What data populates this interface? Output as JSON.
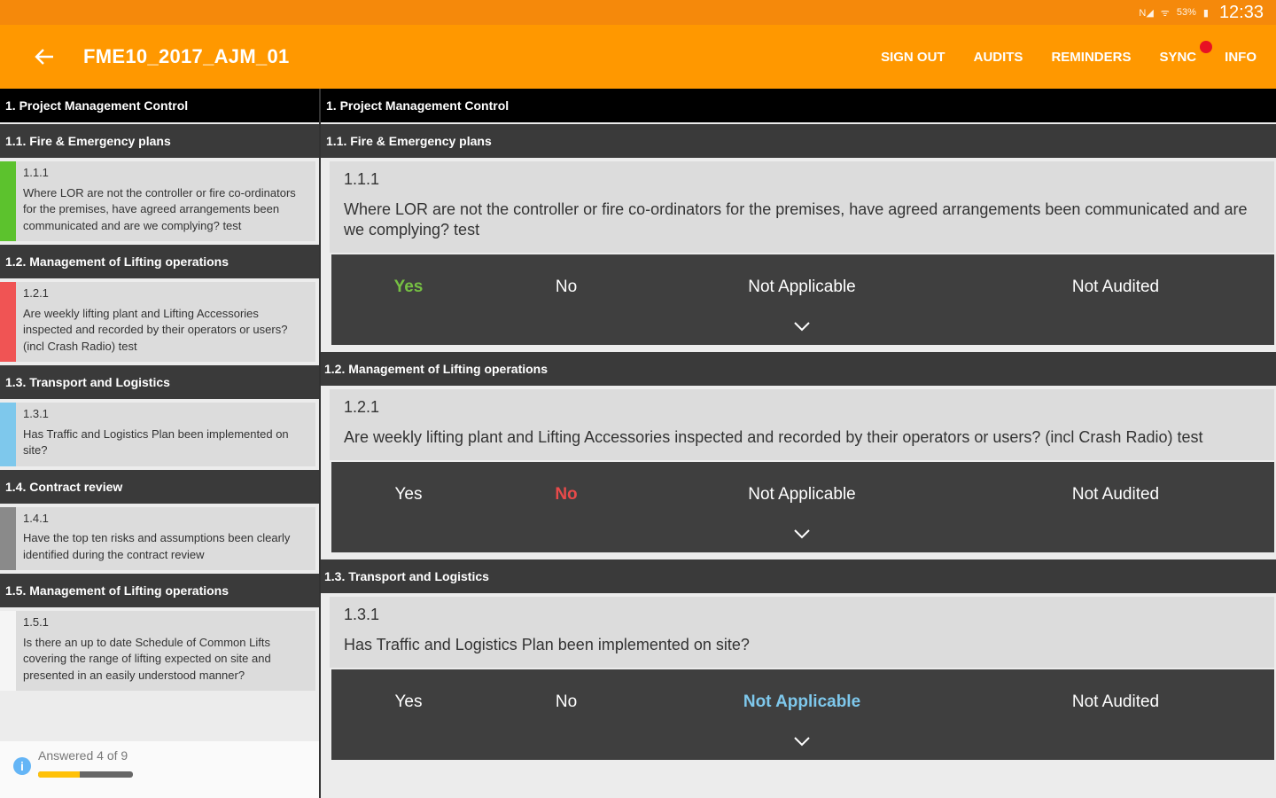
{
  "status": {
    "icons": [
      "nfc-icon",
      "wifi-icon",
      "battery-icon"
    ],
    "battery": "53%",
    "clock": "12:33"
  },
  "appbar": {
    "title": "FME10_2017_AJM_01",
    "actions": [
      "SIGN OUT",
      "AUDITS",
      "REMINDERS",
      "SYNC",
      "INFO"
    ],
    "bg": "#ff9800"
  },
  "left": {
    "section": "1. Project Management Control",
    "groups": [
      {
        "title": "1.1. Fire & Emergency plans",
        "num": "1.1.1",
        "text": "Where LOR are not the controller or fire co-ordinators for the premises, have agreed arrangements been communicated and are we complying? test",
        "status_color": "#5cc22d"
      },
      {
        "title": "1.2. Management of Lifting operations",
        "num": "1.2.1",
        "text": "Are weekly lifting plant and Lifting Accessories inspected and recorded by their operators or users? (incl Crash Radio) test",
        "status_color": "#f05454"
      },
      {
        "title": "1.3. Transport and Logistics",
        "num": "1.3.1",
        "text": "Has Traffic and Logistics Plan been implemented on site?",
        "status_color": "#7ec8ec"
      },
      {
        "title": "1.4. Contract review",
        "num": "1.4.1",
        "text": "Have the top ten risks and assumptions been clearly identified during the contract review",
        "status_color": "#8a8a8a"
      },
      {
        "title": "1.5. Management of Lifting operations",
        "num": "1.5.1",
        "text": "Is there an up to date Schedule of Common Lifts covering the range of lifting expected on site and presented in an easily understood manner?",
        "status_color": "#f5f5f5"
      }
    ],
    "progress": {
      "label": "Answered 4 of 9",
      "fraction": 0.44
    }
  },
  "right": {
    "section": "1. Project Management Control",
    "options": [
      "Yes",
      "No",
      "Not Applicable",
      "Not Audited"
    ],
    "groups": [
      {
        "title": "1.1. Fire & Emergency plans",
        "num": "1.1.1",
        "text": "Where LOR are not the controller or fire co-ordinators for the premises, have agreed arrangements been communicated and are we complying? test",
        "selected": "Yes"
      },
      {
        "title": "1.2. Management of Lifting operations",
        "num": "1.2.1",
        "text": "Are weekly lifting plant and Lifting Accessories inspected and recorded by their operators or users? (incl Crash Radio) test",
        "selected": "No"
      },
      {
        "title": "1.3. Transport and Logistics",
        "num": "1.3.1",
        "text": "Has Traffic and Logistics Plan been implemented on site?",
        "selected": "Not Applicable"
      }
    ]
  }
}
